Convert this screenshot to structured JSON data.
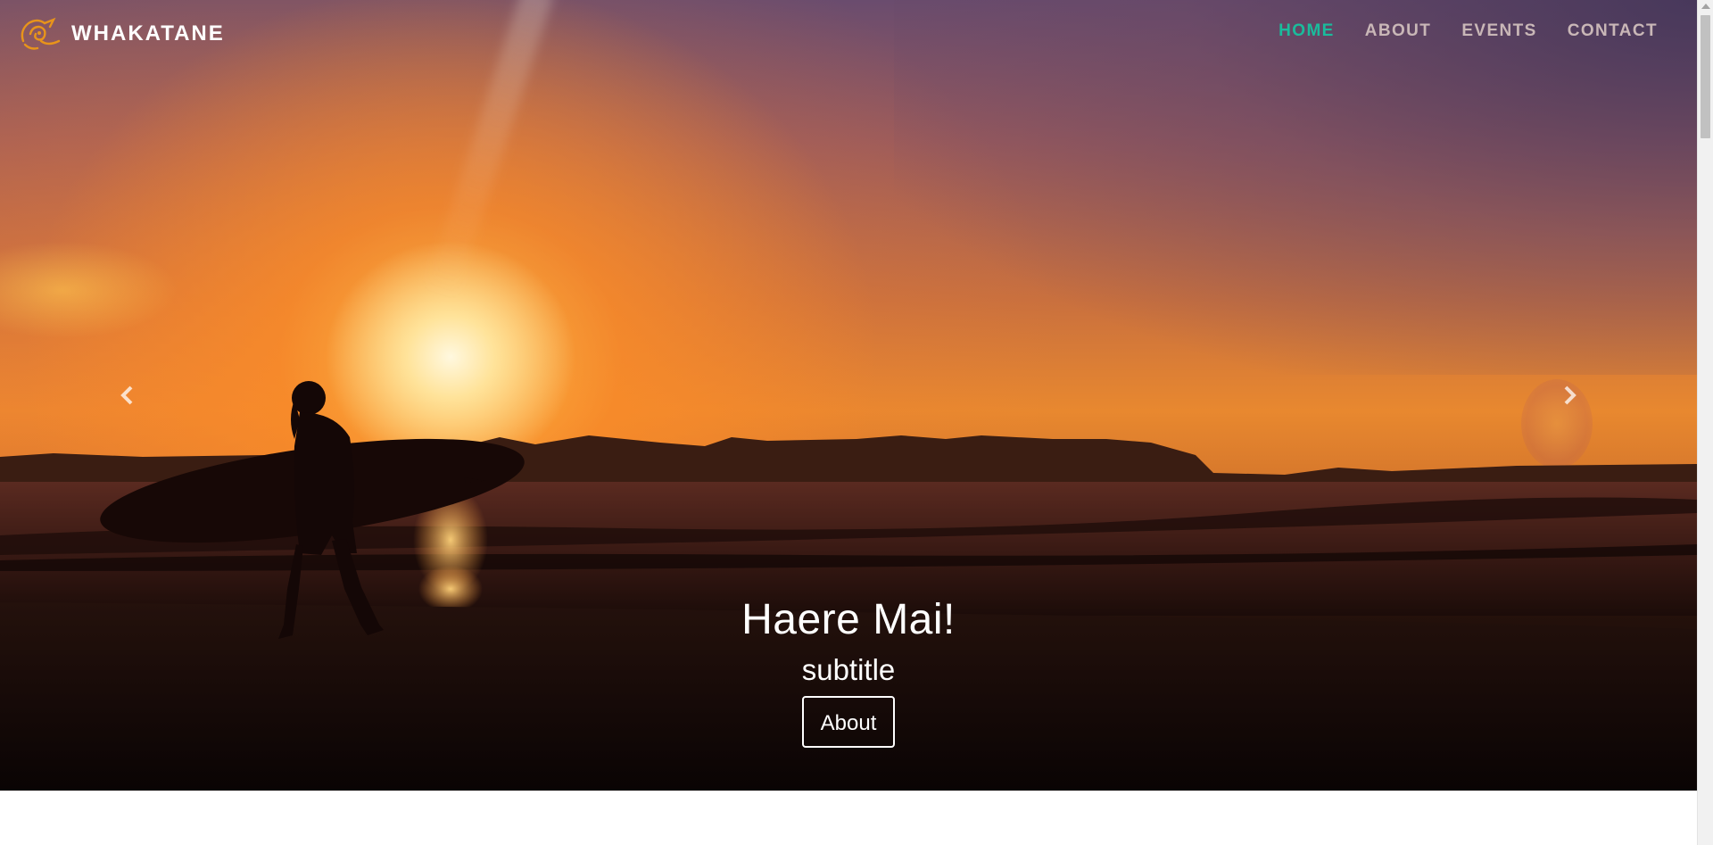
{
  "brand": {
    "name": "WHAKATANE",
    "logo_icon": "koru-bird-logo-icon",
    "logo_color": "#e8941a"
  },
  "nav": {
    "items": [
      {
        "label": "HOME",
        "active": true
      },
      {
        "label": "ABOUT",
        "active": false
      },
      {
        "label": "EVENTS",
        "active": false
      },
      {
        "label": "CONTACT",
        "active": false
      }
    ],
    "active_color": "#1abc9c",
    "inactive_color": "#c9b7b7"
  },
  "carousel": {
    "prev_icon": "chevron-left-icon",
    "next_icon": "chevron-right-icon",
    "caption": {
      "title": "Haere Mai!",
      "subtitle": "subtitle",
      "button_label": "About"
    }
  },
  "colors": {
    "text_on_hero": "#ffffff",
    "page_background": "#ffffff"
  }
}
